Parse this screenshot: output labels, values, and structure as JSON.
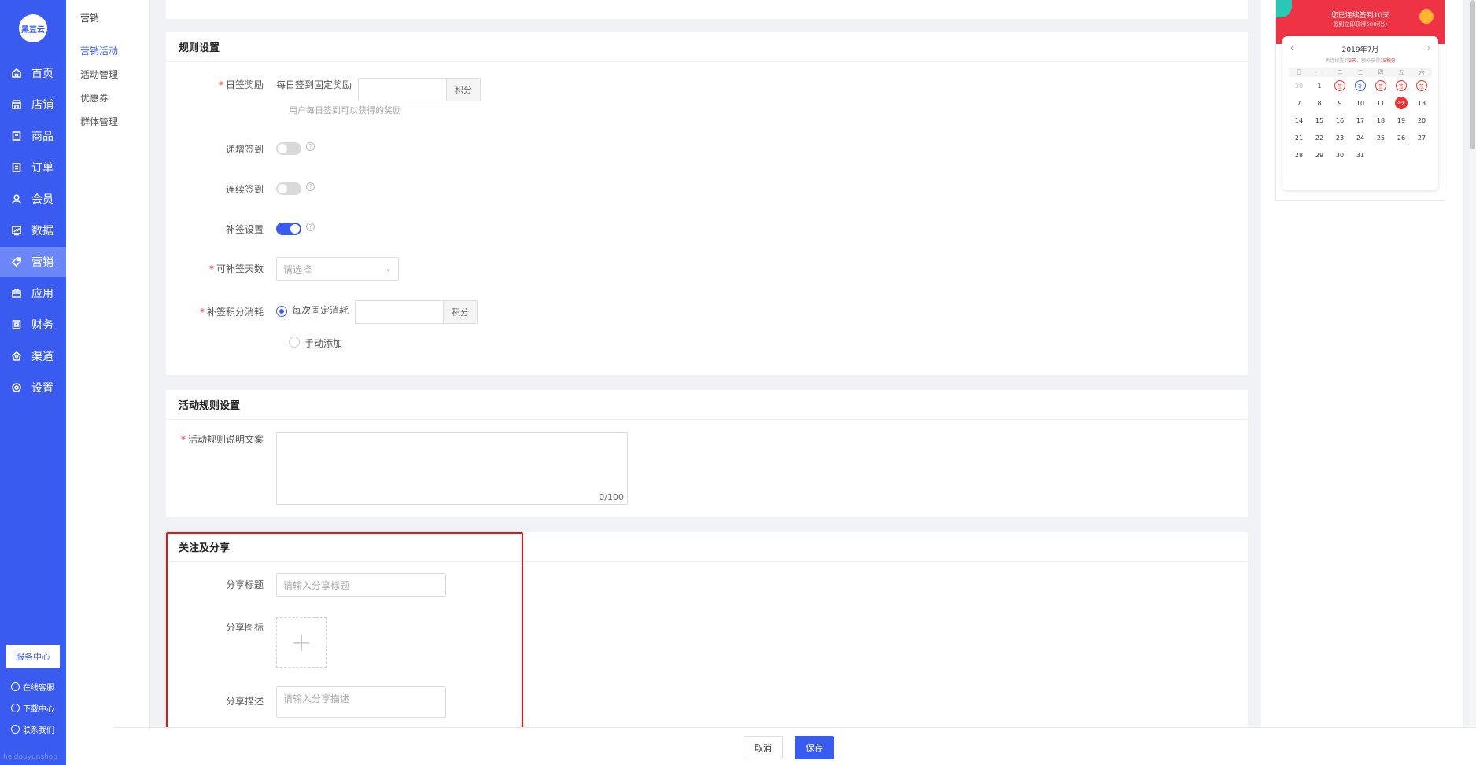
{
  "app": {
    "logo": "黑豆云",
    "brand_footer": "heidouyunshop"
  },
  "mainnav": {
    "items": [
      {
        "label": "首页",
        "icon": "home-icon"
      },
      {
        "label": "店铺",
        "icon": "store-icon"
      },
      {
        "label": "商品",
        "icon": "goods-icon"
      },
      {
        "label": "订单",
        "icon": "order-icon"
      },
      {
        "label": "会员",
        "icon": "member-icon"
      },
      {
        "label": "数据",
        "icon": "chart-icon"
      },
      {
        "label": "营销",
        "icon": "tag-icon"
      },
      {
        "label": "应用",
        "icon": "app-icon"
      },
      {
        "label": "财务",
        "icon": "finance-icon"
      },
      {
        "label": "渠道",
        "icon": "channel-icon"
      },
      {
        "label": "设置",
        "icon": "gear-icon"
      }
    ],
    "service_center": "服务中心",
    "links": [
      "在线客服",
      "下载中心",
      "联系我们"
    ]
  },
  "subnav": {
    "title": "营销",
    "items": [
      "营销活动",
      "活动管理",
      "优惠券",
      "群体管理"
    ]
  },
  "rules": {
    "title": "规则设置",
    "daily_reward_label": "日签奖励",
    "daily_reward_text": "每日签到固定奖励",
    "unit": "积分",
    "daily_reward_hint": "用户每日签到可以获得的奖励",
    "increment_label": "递增签到",
    "continuous_label": "连续签到",
    "makeup_label": "补签设置",
    "makeup_days_label": "可补签天数",
    "makeup_days_placeholder": "请选择",
    "makeup_cost_label": "补签积分消耗",
    "option_fixed": "每次固定消耗",
    "option_manual": "手动添加"
  },
  "activity_rules": {
    "title": "活动规则设置",
    "label": "活动规则说明文案",
    "count": "0/100"
  },
  "share": {
    "title": "关注及分享",
    "title_label": "分享标题",
    "title_placeholder": "请输入分享标题",
    "icon_label": "分享图标",
    "desc_label": "分享描述",
    "desc_placeholder": "请输入分享描述"
  },
  "preview": {
    "banner_line1": "您已连续签到10天",
    "banner_line2": "签到立即获得500积分",
    "month": "2019年7月",
    "sub_prefix": "再连续签到",
    "sub_days": "2天",
    "sub_mid": "，额外获得",
    "sub_points": "15积分",
    "weekdays": [
      "日",
      "一",
      "二",
      "三",
      "四",
      "五",
      "六"
    ],
    "days": [
      {
        "d": "30",
        "t": "muted"
      },
      {
        "d": "1"
      },
      {
        "d": "签",
        "t": "mk"
      },
      {
        "d": "补",
        "t": "mkb"
      },
      {
        "d": "签",
        "t": "mk"
      },
      {
        "d": "签",
        "t": "mk"
      },
      {
        "d": "签",
        "t": "mk"
      },
      {
        "d": "7"
      },
      {
        "d": "8"
      },
      {
        "d": "9"
      },
      {
        "d": "10"
      },
      {
        "d": "11"
      },
      {
        "d": "今天",
        "t": "today"
      },
      {
        "d": "13"
      },
      {
        "d": "14"
      },
      {
        "d": "15"
      },
      {
        "d": "16"
      },
      {
        "d": "17"
      },
      {
        "d": "18"
      },
      {
        "d": "19"
      },
      {
        "d": "20"
      },
      {
        "d": "21"
      },
      {
        "d": "22"
      },
      {
        "d": "23"
      },
      {
        "d": "24"
      },
      {
        "d": "25"
      },
      {
        "d": "26"
      },
      {
        "d": "27"
      },
      {
        "d": "28"
      },
      {
        "d": "29"
      },
      {
        "d": "30"
      },
      {
        "d": "31"
      }
    ]
  },
  "footer": {
    "cancel": "取消",
    "save": "保存"
  },
  "colors": {
    "primary": "#3a5bf0",
    "danger": "#e11111",
    "banner": "#ee3344"
  }
}
